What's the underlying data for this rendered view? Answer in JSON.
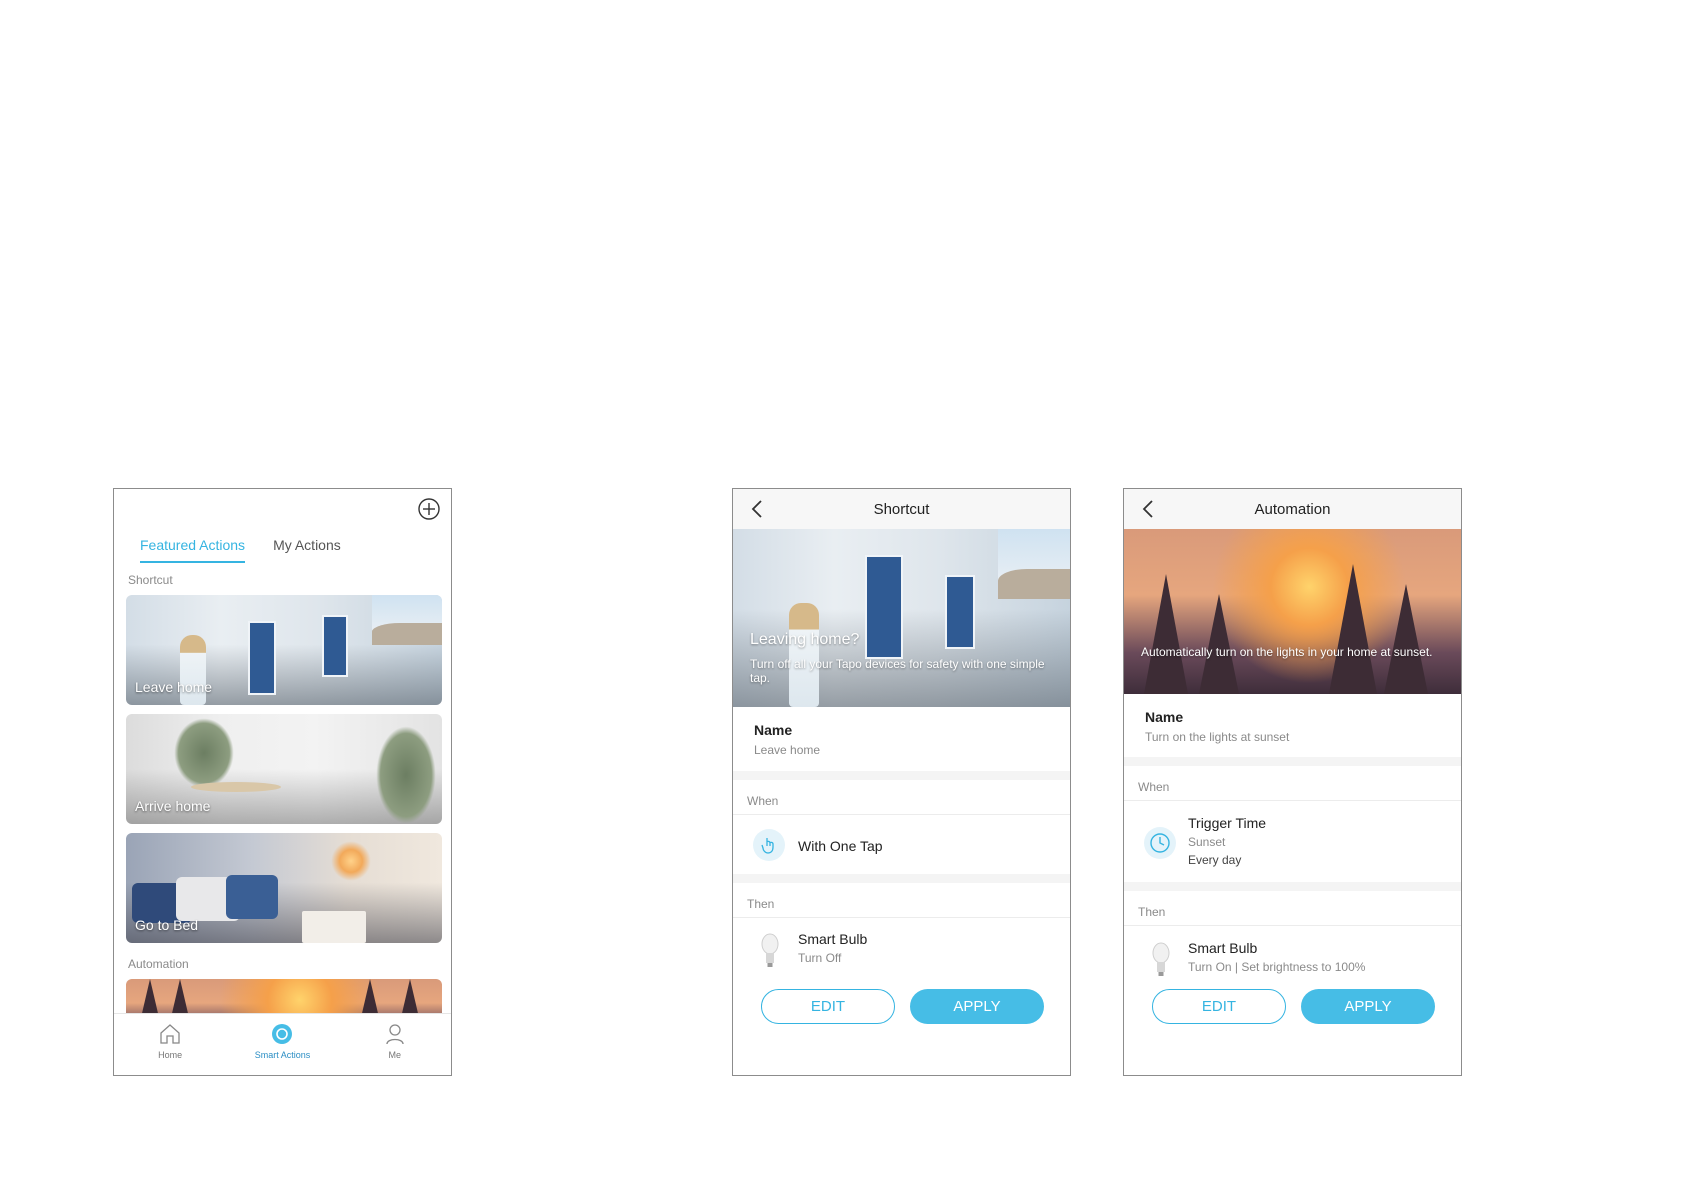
{
  "phone1": {
    "tabs": [
      "Featured Actions",
      "My Actions"
    ],
    "shortcut_label": "Shortcut",
    "cards": [
      "Leave home",
      "Arrive home",
      "Go to Bed"
    ],
    "automation_label": "Automation",
    "nav": [
      "Home",
      "Smart Actions",
      "Me"
    ]
  },
  "shortcut": {
    "title": "Shortcut",
    "hero_title": "Leaving home?",
    "hero_desc": "Turn off all your Tapo devices for safety with one simple tap.",
    "name_label": "Name",
    "name_value": "Leave home",
    "when_label": "When",
    "when_value": "With One Tap",
    "then_label": "Then",
    "device": "Smart Bulb",
    "device_action": "Turn Off",
    "edit": "EDIT",
    "apply": "APPLY"
  },
  "automation": {
    "title": "Automation",
    "hero_desc": "Automatically turn on the lights in your home at sunset.",
    "name_label": "Name",
    "name_value": "Turn on the lights at sunset",
    "when_label": "When",
    "trigger": "Trigger Time",
    "trigger_sub1": "Sunset",
    "trigger_sub2": "Every day",
    "then_label": "Then",
    "device": "Smart Bulb",
    "device_action": "Turn On | Set brightness to 100%",
    "edit": "EDIT",
    "apply": "APPLY"
  },
  "colors": {
    "accent": "#35b4e1",
    "apply_fill": "#46bde6",
    "nav_active": "#2b8ec4"
  }
}
